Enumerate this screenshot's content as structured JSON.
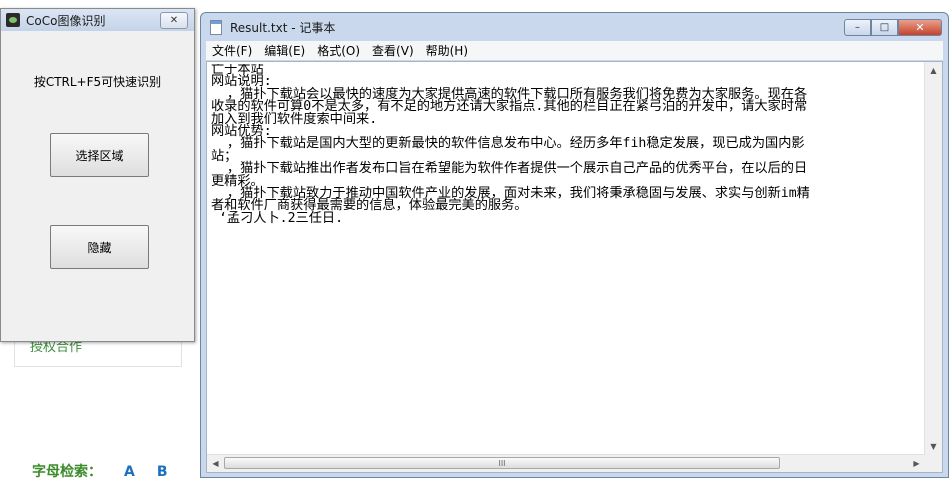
{
  "background": {
    "link_text": "授权合作",
    "alpha_label": "字母检索：",
    "letters": [
      "A",
      "B"
    ]
  },
  "coco": {
    "title": "CoCo图像识别",
    "close_glyph": "✕",
    "hint": "按CTRL+F5可快速识别",
    "select_button": "选择区域",
    "hide_button": "隐藏"
  },
  "notepad": {
    "title": "Result.txt - 记事本",
    "ctrl_min": "–",
    "ctrl_max": "□",
    "ctrl_close": "✕",
    "menu": [
      "文件(F)",
      "编辑(E)",
      "格式(O)",
      "查看(V)",
      "帮助(H)"
    ],
    "text": "亡于本站\n网站说明:\n  ，猫扑下载站会以最快的速度为大家提供高速的软件下载口所有服务我们将免费为大家服务。现在各\n收录的软件可算0不是太多，有不足的地方还请大家指点.其他的栏目正在紧弓泊的开发中，请大家时常\n加入到我们软件度索中间来.\n网站优势:\n  ，猫扑下载站是国内大型的更新最快的软件信息发布中心。经历多年fih稳定发展，现已成为国内影\n站；\n  ，猫扑下载站推出作者发布口旨在希望能为软件作者提供一个展示自己产品的优秀平台，在以后的日\n更精彩。\n  ，猫扑下载站致力于推动中国软件产业的发展，面对未来，我们将秉承稳固与发展、求实与创新im精\n者和软件厂商获得最需要的信息，体验最完美的服务。\n ‘孟刁人卜.2三任日.",
    "scroll_up": "▲",
    "scroll_down": "▼",
    "scroll_left": "◀",
    "scroll_right": "▶",
    "thumb_grip": "III"
  }
}
